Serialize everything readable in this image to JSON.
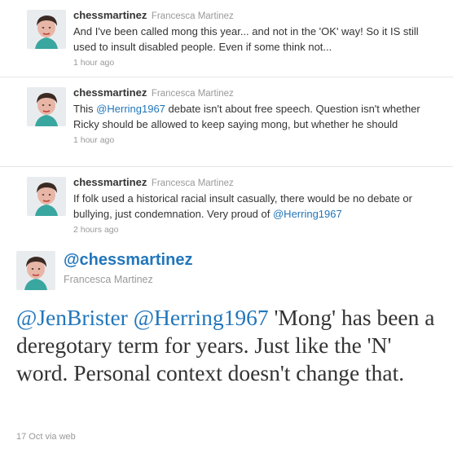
{
  "colors": {
    "link": "#2276bb",
    "muted": "#999999",
    "text": "#333333",
    "divider": "#e6e6e6"
  },
  "timeline": [
    {
      "screen_name": "chessmartinez",
      "full_name": "Francesca Martinez",
      "text_before": "And I've been called mong this year... and not in the 'OK' way! So it IS still used to insult disabled people. Even if some think not...",
      "mention": "",
      "text_after": "",
      "timestamp": "1 hour ago",
      "avatar_icon": "profile-photo-icon"
    },
    {
      "screen_name": "chessmartinez",
      "full_name": "Francesca Martinez",
      "text_before": "This ",
      "mention": "@Herring1967",
      "text_after": " debate isn't about free speech. Question isn't whether Ricky should be allowed to keep saying mong, but whether he should",
      "timestamp": "1 hour ago",
      "avatar_icon": "profile-photo-icon"
    },
    {
      "screen_name": "chessmartinez",
      "full_name": "Francesca Martinez",
      "text_before": "If folk used a historical racial insult casually, there would be no debate or bullying, just condemnation. Very proud of ",
      "mention": "@Herring1967",
      "text_after": "",
      "timestamp": "2 hours ago",
      "avatar_icon": "profile-photo-icon"
    }
  ],
  "featured": {
    "screen_name": "@chessmartinez",
    "full_name": "Francesca Martinez",
    "mention_1": "@JenBrister",
    "mention_2": "@Herring1967",
    "text": " 'Mong' has been a deregotary term for years. Just like the 'N' word. Personal context doesn't change that.",
    "meta": "17 Oct via web",
    "avatar_icon": "profile-photo-icon"
  }
}
